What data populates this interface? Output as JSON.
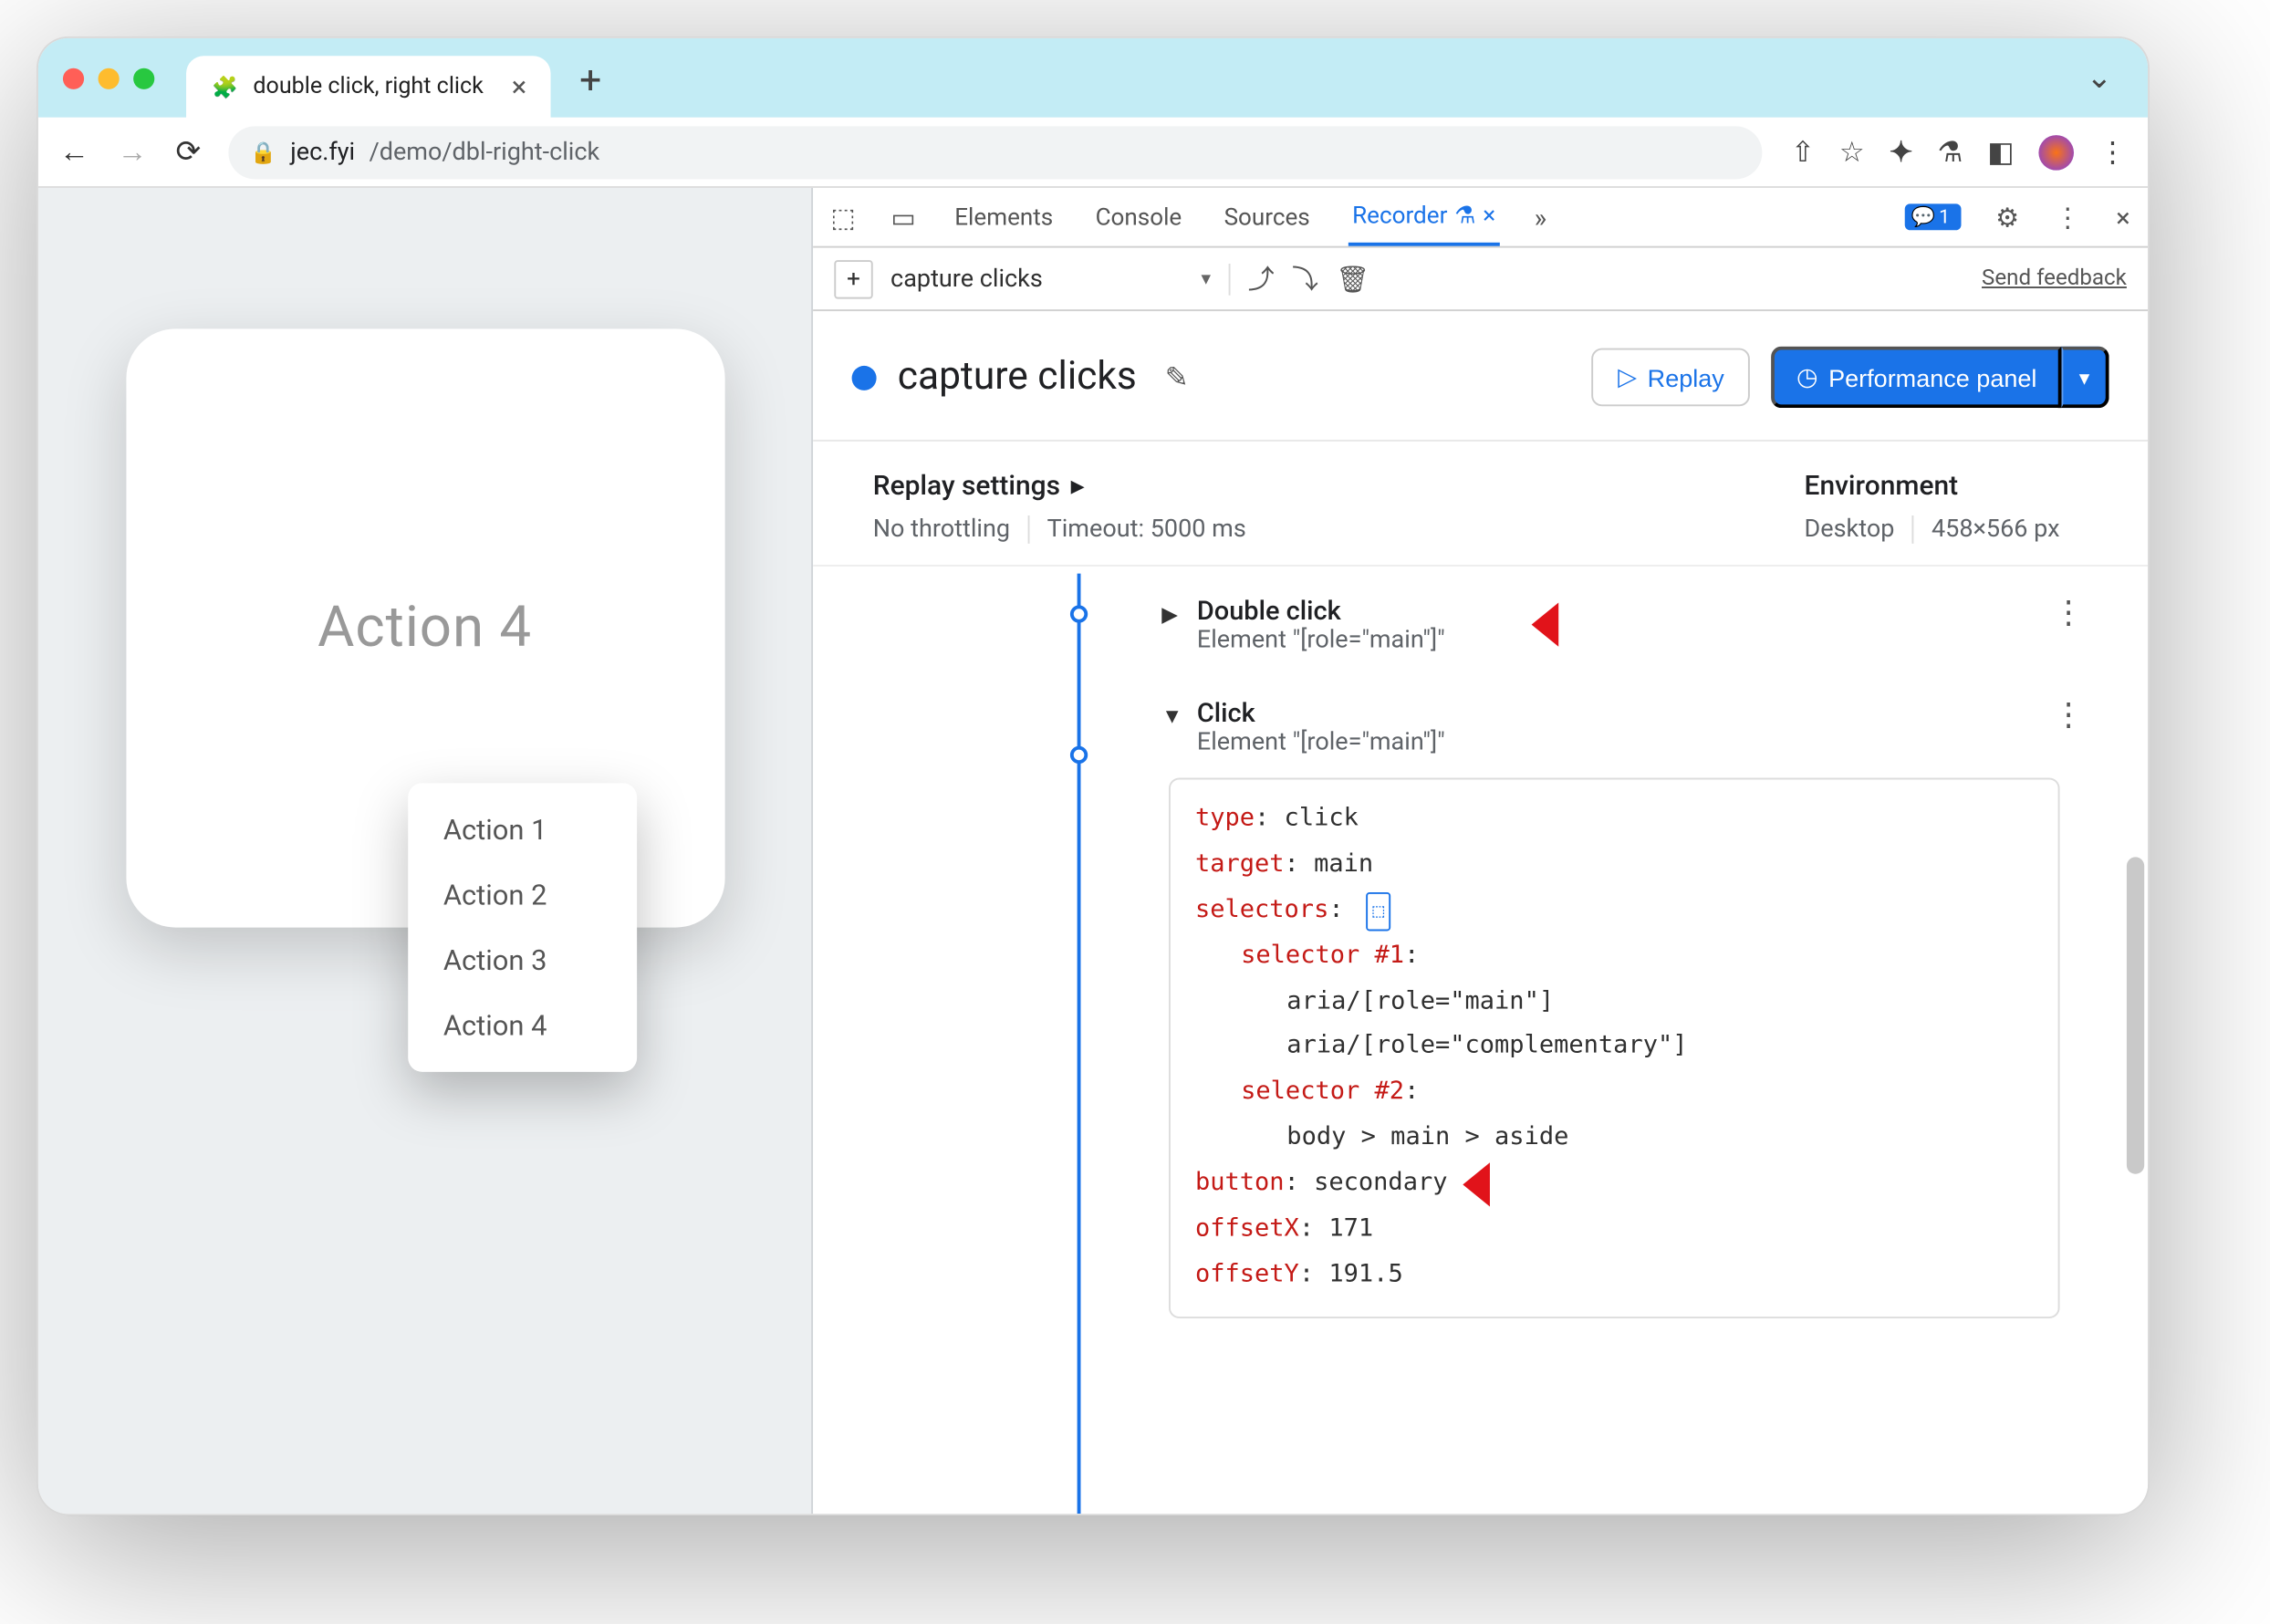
{
  "browser": {
    "tab_title": "double click, right click",
    "url_host": "jec.fyi",
    "url_path": "/demo/dbl-right-click",
    "issues_count": "1"
  },
  "page": {
    "card_title": "Action 4",
    "menu": [
      "Action 1",
      "Action 2",
      "Action 3",
      "Action 4"
    ]
  },
  "devtools": {
    "tabs": {
      "elements": "Elements",
      "console": "Console",
      "sources": "Sources",
      "recorder": "Recorder"
    },
    "recording_name": "capture clicks",
    "feedback": "Send feedback",
    "recorder_title": "capture clicks",
    "replay_btn": "Replay",
    "perf_btn": "Performance panel",
    "settings": {
      "replay_h": "Replay settings",
      "throttling": "No throttling",
      "timeout": "Timeout: 5000 ms",
      "env_h": "Environment",
      "device": "Desktop",
      "viewport": "458×566 px"
    },
    "steps": [
      {
        "title": "Double click",
        "sub": "Element \"[role=\"main\"]\""
      },
      {
        "title": "Click",
        "sub": "Element \"[role=\"main\"]\""
      }
    ],
    "detail": {
      "type_k": "type",
      "type_v": "click",
      "target_k": "target",
      "target_v": "main",
      "selectors_k": "selectors",
      "sel1_k": "selector #1",
      "sel1_a": "aria/[role=\"main\"]",
      "sel1_b": "aria/[role=\"complementary\"]",
      "sel2_k": "selector #2",
      "sel2_a": "body > main > aside",
      "button_k": "button",
      "button_v": "secondary",
      "ox_k": "offsetX",
      "ox_v": "171",
      "oy_k": "offsetY",
      "oy_v": "191.5"
    }
  }
}
